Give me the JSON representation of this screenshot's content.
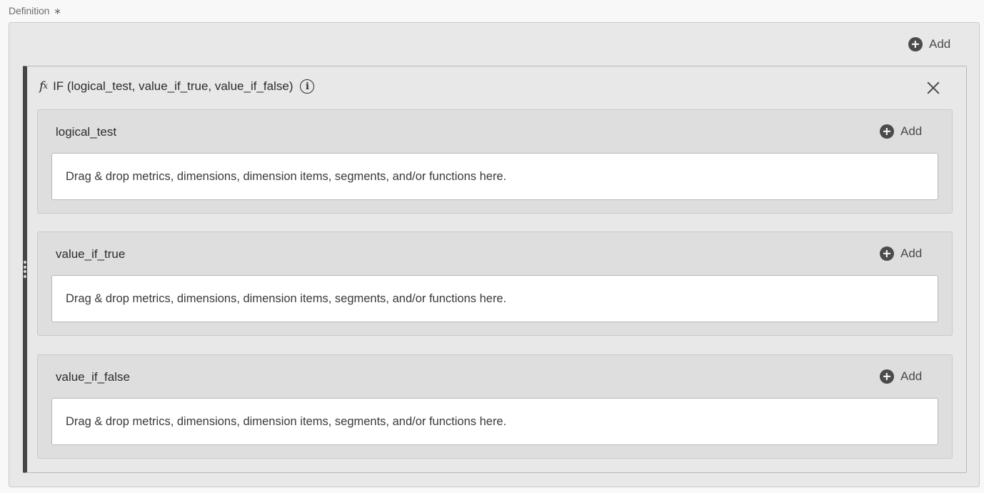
{
  "definition": {
    "label": "Definition",
    "required_marker": "∗"
  },
  "outer": {
    "add_label": "Add"
  },
  "function": {
    "fx_symbol": "f",
    "fx_sub": "x",
    "signature": "IF (logical_test, value_if_true, value_if_false)",
    "info_glyph": "i",
    "icons": {
      "fx": "function-icon",
      "info": "info-icon",
      "close": "close-icon",
      "add": "add-circle-icon",
      "drag": "drag-handle-icon"
    },
    "arguments": [
      {
        "name": "logical_test",
        "add_label": "Add",
        "drop_placeholder": "Drag & drop metrics, dimensions, dimension items, segments, and/or functions here."
      },
      {
        "name": "value_if_true",
        "add_label": "Add",
        "drop_placeholder": "Drag & drop metrics, dimensions, dimension items, segments, and/or functions here."
      },
      {
        "name": "value_if_false",
        "add_label": "Add",
        "drop_placeholder": "Drag & drop metrics, dimensions, dimension items, segments, and/or functions here."
      }
    ]
  }
}
